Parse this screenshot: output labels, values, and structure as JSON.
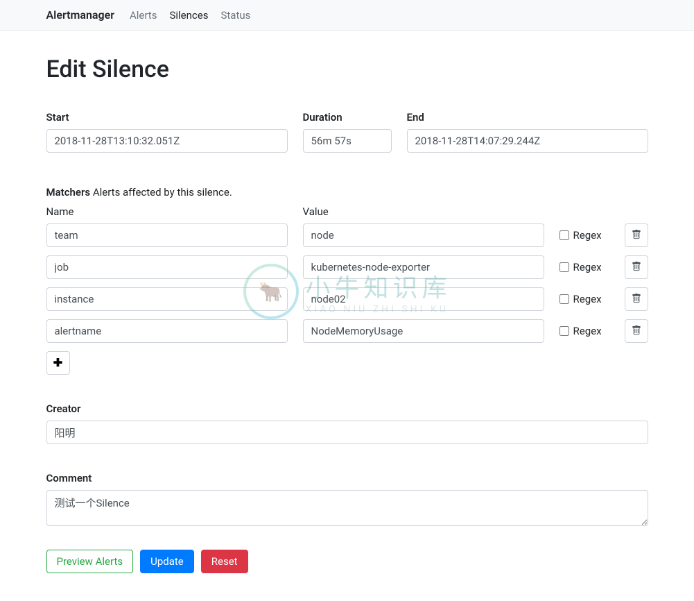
{
  "nav": {
    "brand": "Alertmanager",
    "links": [
      {
        "label": "Alerts",
        "active": false
      },
      {
        "label": "Silences",
        "active": true
      },
      {
        "label": "Status",
        "active": false
      }
    ]
  },
  "page": {
    "title": "Edit Silence"
  },
  "form": {
    "start": {
      "label": "Start",
      "value": "2018-11-28T13:10:32.051Z"
    },
    "duration": {
      "label": "Duration",
      "value": "56m 57s"
    },
    "end": {
      "label": "End",
      "value": "2018-11-28T14:07:29.244Z"
    },
    "matchers": {
      "title": "Matchers",
      "subtitle": "Alerts affected by this silence.",
      "name_header": "Name",
      "value_header": "Value",
      "regex_label": "Regex",
      "rows": [
        {
          "name": "team",
          "value": "node",
          "regex": false
        },
        {
          "name": "job",
          "value": "kubernetes-node-exporter",
          "regex": false
        },
        {
          "name": "instance",
          "value": "node02",
          "regex": false
        },
        {
          "name": "alertname",
          "value": "NodeMemoryUsage",
          "regex": false
        }
      ]
    },
    "creator": {
      "label": "Creator",
      "value": "阳明"
    },
    "comment": {
      "label": "Comment",
      "value": "测试一个Silence"
    }
  },
  "actions": {
    "preview": "Preview Alerts",
    "update": "Update",
    "reset": "Reset"
  },
  "watermark": {
    "text": "小牛知识库",
    "sub": "XIAO NIU ZHI SHI KU"
  }
}
